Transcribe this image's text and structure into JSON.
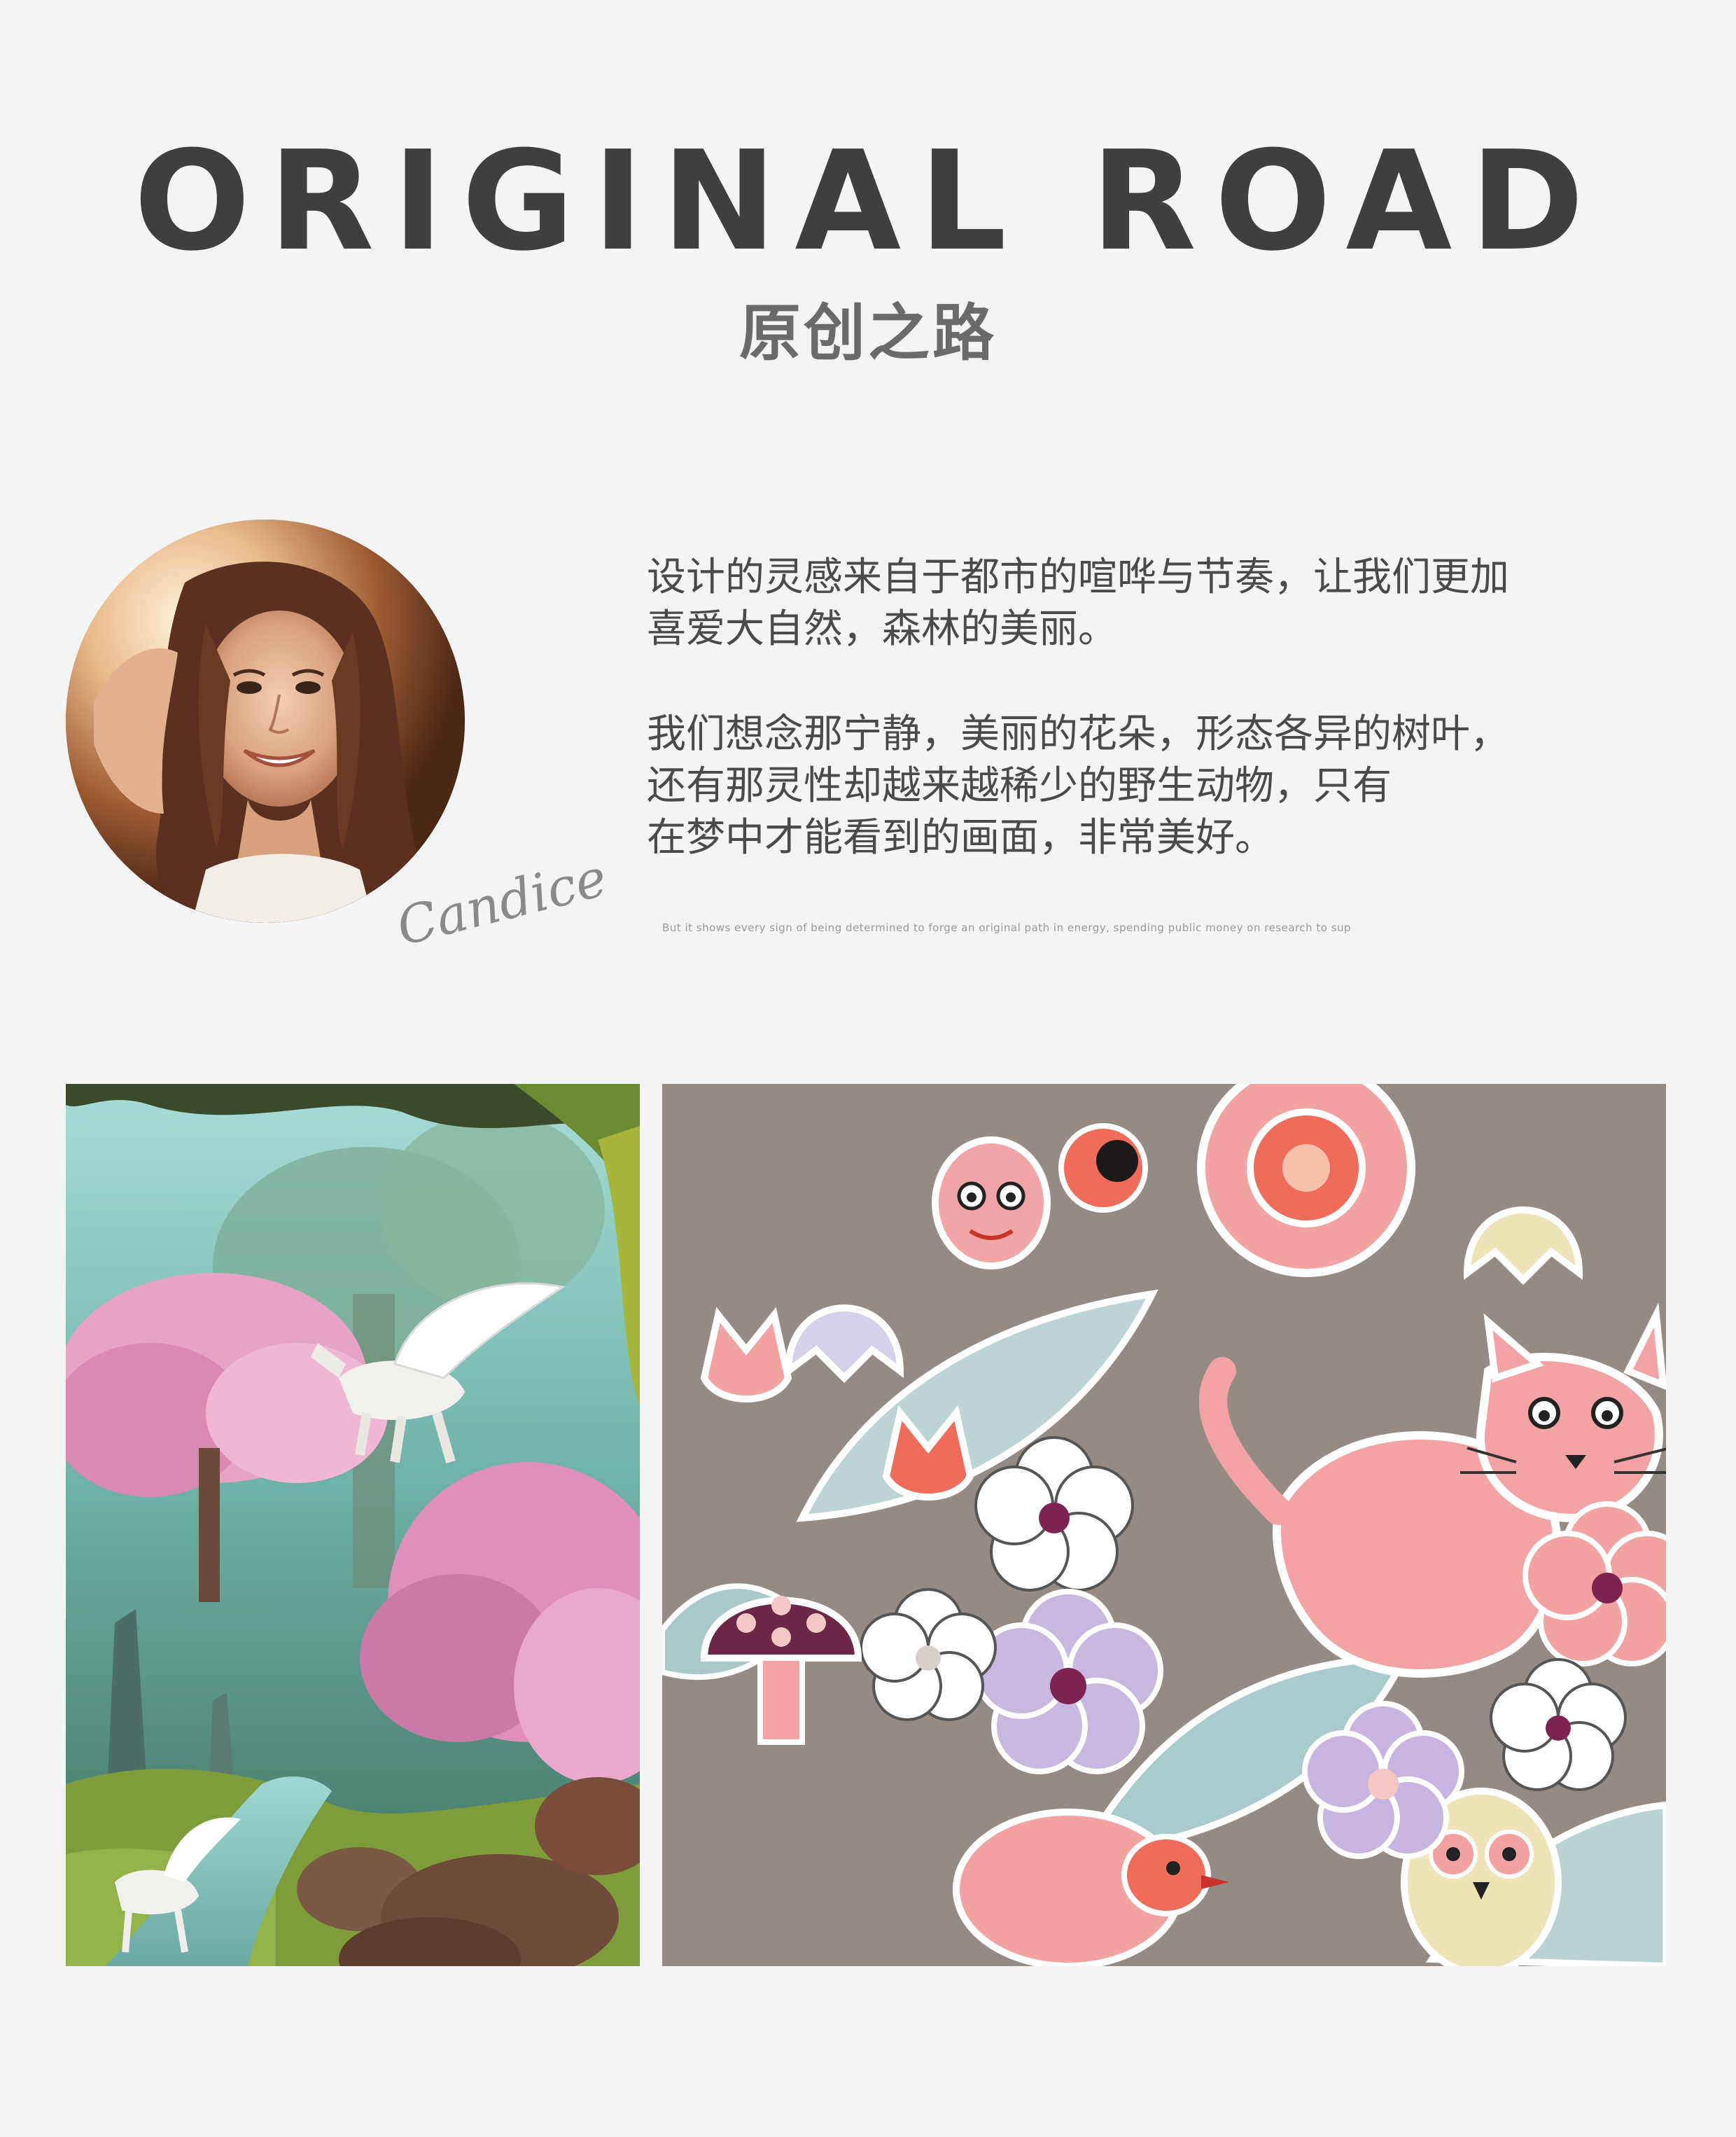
{
  "header": {
    "title": "ORIGINAL ROAD",
    "subtitle": "原创之路"
  },
  "designer": {
    "signature": "Candice"
  },
  "intro": {
    "paragraph1": [
      "设计的灵感来自于都市的喧哗与节奏，让我们更加",
      "喜爱大自然，森林的美丽。"
    ],
    "paragraph2": [
      "我们想念那宁静，美丽的花朵，形态各异的树叶，",
      "还有那灵性却越来越稀少的野生动物，只有",
      "在梦中才能看到的画面，非常美好。"
    ],
    "fine_print": "But it shows every sign of being determined to forge an original path in energy, spending public money on research to sup"
  },
  "images": {
    "left_icon": "fantasy-forest-pegasus-illustration",
    "right_icon": "floral-animal-pattern-illustration"
  },
  "colors": {
    "background": "#f4f4f4",
    "title": "#3f3f3f",
    "subtitle": "#6a6a6a",
    "body_text": "#4a4a4a"
  }
}
